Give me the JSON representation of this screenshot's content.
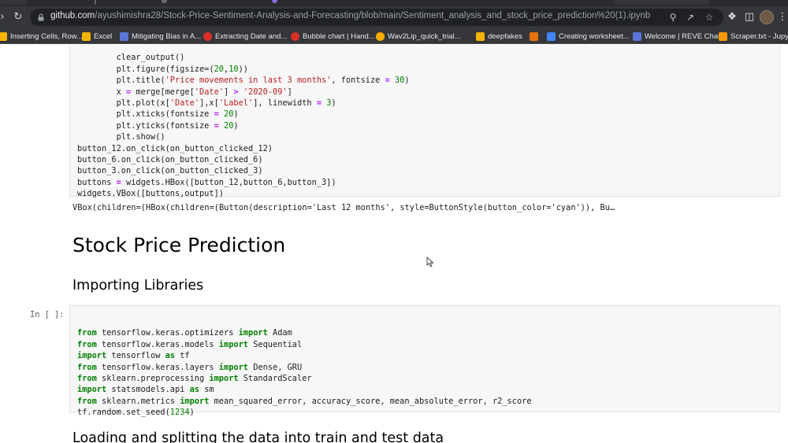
{
  "browser": {
    "url_host": "github.com",
    "url_path": "/ayushimishra28/Stock-Price-Sentiment-Analysis-and-Forecasting/blob/main/Sentiment_analysis_and_stock_price_prediction%20(1).ipynb",
    "nav": {
      "forward_icon": "arrow-right-icon",
      "reload_icon": "reload-icon"
    },
    "bookmarks": [
      {
        "label": "Inserting Cells, Row...",
        "color": "#f4b400"
      },
      {
        "label": "Excel",
        "color": "#f4b400"
      },
      {
        "label": "Mitigating Bias in A...",
        "color": "#5a74d8"
      },
      {
        "label": "Extracting Date and...",
        "color": "#d93025"
      },
      {
        "label": "Bubble chart | Hand...",
        "color": "#d93025"
      },
      {
        "label": "Wav2Lip_quick_trial...",
        "color": "#f9ab00"
      },
      {
        "label": "deepfakes",
        "color": "#f4b400"
      },
      {
        "label": "Creating worksheet...",
        "color": "#4285f4"
      },
      {
        "label": "Welcome | REVE Chat",
        "color": "#5a74d8"
      },
      {
        "label": "Scraper.txt - Jupyte",
        "color": "#f29900"
      }
    ]
  },
  "notebook": {
    "cell1_lines": [
      "        clear_output()",
      "        plt.figure(figsize=(20,10))",
      "        plt.title('Price movements in last 3 months', fontsize = 30)",
      "        x = merge[merge['Date'] > '2020-09']",
      "        plt.plot(x['Date'],x['Label'], linewidth = 3)",
      "        plt.xticks(fontsize = 20)",
      "        plt.yticks(fontsize = 20)",
      "        plt.show()",
      "button_12.on_click(on_button_clicked_12)",
      "button_6.on_click(on_button_clicked_6)",
      "button_3.on_click(on_button_clicked_3)",
      "buttons = widgets.HBox([button_12,button_6,button_3])",
      "widgets.VBox([buttons,output])"
    ],
    "output_text": "VBox(children=(HBox(children=(Button(description='Last 12 months', style=ButtonStyle(button_color='cyan')), Bu…",
    "heading": "Stock Price Prediction",
    "subheading": "Importing Libraries",
    "prompt": "In [ ]:",
    "cell2_lines": [
      "from tensorflow.keras.optimizers import Adam",
      "from tensorflow.keras.models import Sequential",
      "import tensorflow as tf",
      "from tensorflow.keras.layers import Dense, GRU",
      "from sklearn.preprocessing import StandardScaler",
      "import statsmodels.api as sm",
      "from sklearn.metrics import mean_squared_error, accuracy_score, mean_absolute_error, r2_score",
      "tf.random.set_seed(1234)"
    ],
    "subheading2": "Loading and splitting the data into train and test data"
  }
}
